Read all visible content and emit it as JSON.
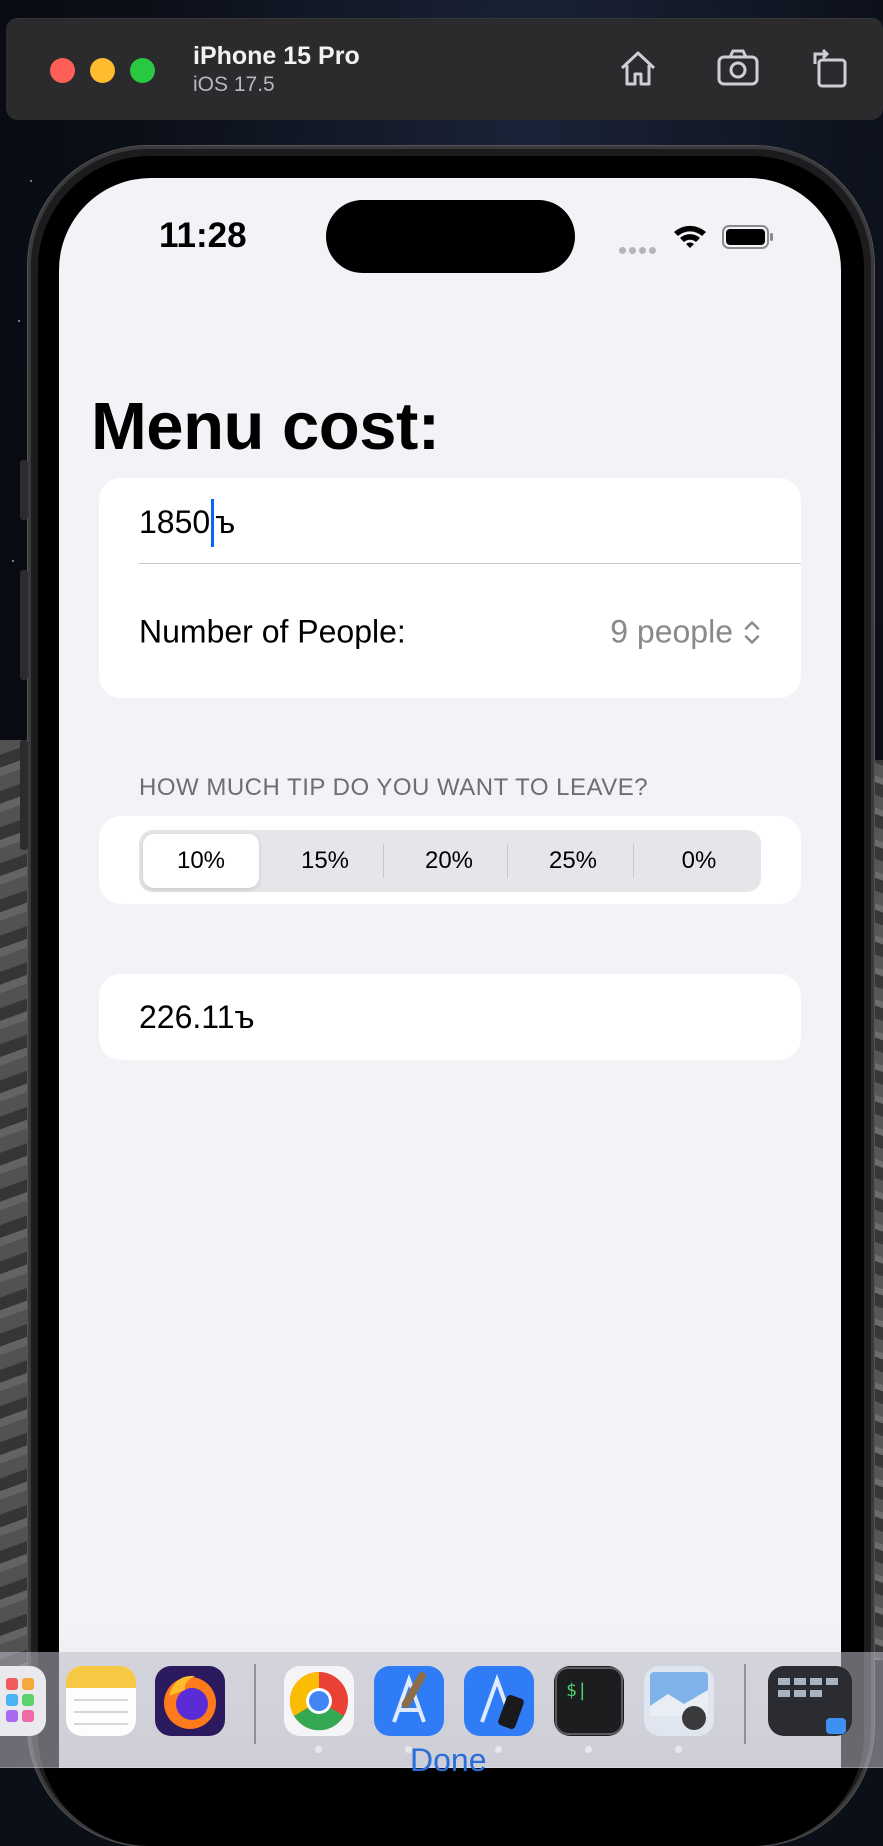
{
  "simulator": {
    "device_name": "iPhone 15 Pro",
    "os_version": "iOS 17.5",
    "toolbar_icons": [
      "home-icon",
      "camera-icon",
      "rotate-icon"
    ]
  },
  "status_bar": {
    "time": "11:28",
    "icons": [
      "cellular-signal-icon",
      "wifi-icon",
      "battery-icon"
    ]
  },
  "page": {
    "title": "Menu cost:",
    "cost_value": "1850",
    "cost_suffix": "ъ",
    "people_label": "Number of People:",
    "people_value": "9 people",
    "tip_header": "HOW MUCH TIP DO YOU WANT TO LEAVE?",
    "tip_options": [
      "10%",
      "15%",
      "20%",
      "25%",
      "0%"
    ],
    "tip_selected": "10%",
    "result": "226.11ъ"
  },
  "keyboard_toolbar": {
    "done_label": "Done"
  },
  "dock": {
    "apps": [
      "launchpad-icon",
      "notes-icon",
      "firefox-icon",
      "chrome-icon",
      "xcode-icon",
      "simulator-icon",
      "terminal-icon",
      "preview-icon",
      "mission-control-icon"
    ]
  },
  "colors": {
    "accent": "#0a63ff",
    "background": "#f2f2f7",
    "card": "#ffffff",
    "secondary_text": "#8a8a8e"
  }
}
